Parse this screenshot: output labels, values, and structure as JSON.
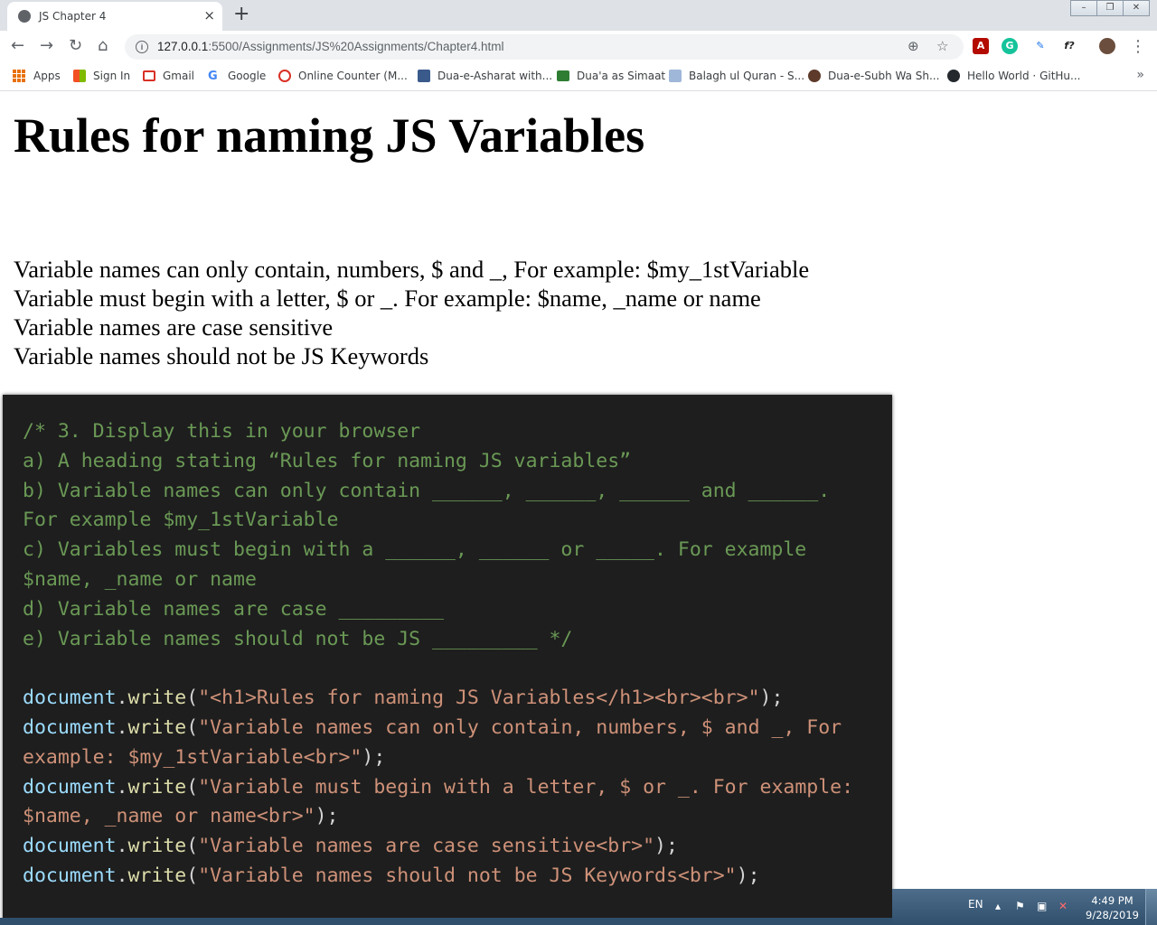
{
  "browser": {
    "tab_title": "JS Chapter 4",
    "tab_close": "×",
    "new_tab": "+",
    "url_host": "127.0.0.1",
    "url_path": ":5500/Assignments/JS%20Assignments/Chapter4.html",
    "extension_label": "f?"
  },
  "bookmarks": [
    {
      "label": "Apps"
    },
    {
      "label": "Sign In"
    },
    {
      "label": "Gmail"
    },
    {
      "label": "Google"
    },
    {
      "label": "Online Counter (M..."
    },
    {
      "label": "Dua-e-Asharat with..."
    },
    {
      "label": "Dua'a as Simaat"
    },
    {
      "label": "Balagh ul Quran - S..."
    },
    {
      "label": "Dua-e-Subh Wa Sh..."
    },
    {
      "label": "Hello World · GitHu..."
    }
  ],
  "bookmarks_more": "»",
  "page": {
    "heading": "Rules for naming JS Variables",
    "rules": [
      "Variable names can only contain, numbers, $ and _, For example: $my_1stVariable",
      "Variable must begin with a letter, $ or _. For example: $name, _name or name",
      "Variable names are case sensitive",
      "Variable names should not be JS Keywords"
    ]
  },
  "code": {
    "comment_lines": [
      "/* 3. Display this in your browser",
      "a) A heading stating “Rules for naming JS variables”",
      "b) Variable names can only contain ______, ______, ______ and ______.",
      "For example $my_1stVariable",
      "c) Variables must begin with a ______, ______ or _____. For example",
      "$name, _name or name",
      "d) Variable names are case _________",
      "e) Variable names should not be JS _________ */"
    ],
    "obj": "document",
    "dot": ".",
    "fn": "write",
    "open": "(",
    "close": ");",
    "strings": {
      "s1": "\"<h1>Rules for naming JS Variables</h1><br><br>\"",
      "s2a": "\"Variable names can only contain, numbers, $ and _, For",
      "s2b": "example: $my_1stVariable<br>\"",
      "s3a": "\"Variable must begin with a letter, $ or _. For example:",
      "s3b": "$name, _name or name<br>\"",
      "s4": "\"Variable names are case sensitive<br>\"",
      "s5": "\"Variable names should not be JS Keywords<br>\""
    }
  },
  "taskbar": {
    "lang": "EN",
    "time": "4:49 PM",
    "date": "9/28/2019"
  }
}
